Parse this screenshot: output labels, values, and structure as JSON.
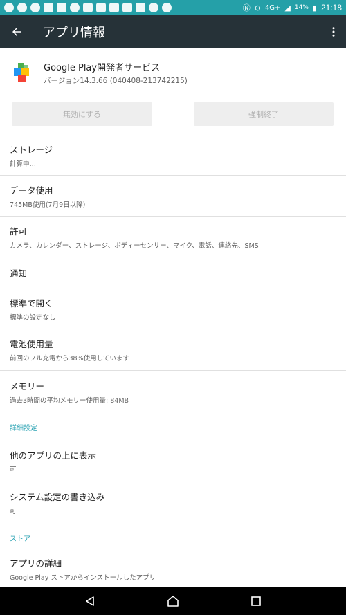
{
  "status_bar": {
    "time": "21:18",
    "battery": "14%",
    "network": "4G+",
    "icons": [
      "message-icon",
      "chat-icon",
      "chat-icon",
      "vine-icon",
      "vine-icon",
      "pinwheel-icon",
      "app-icon",
      "mail-icon",
      "flipboard-icon",
      "home-icon",
      "gmail-icon",
      "chat-bubble-icon",
      "line-icon"
    ]
  },
  "app_bar": {
    "title": "アプリ情報"
  },
  "app": {
    "name": "Google Play開発者サービス",
    "version": "バージョン14.3.66 (040408-213742215)"
  },
  "buttons": {
    "disable": "無効にする",
    "force_stop": "強制終了"
  },
  "items": {
    "storage": {
      "title": "ストレージ",
      "sub": "計算中…"
    },
    "data": {
      "title": "データ使用",
      "sub": "745MB使用(7月9日以降)"
    },
    "permissions": {
      "title": "許可",
      "sub": "カメラ、カレンダー、ストレージ、ボディーセンサー、マイク、電話、連絡先、SMS"
    },
    "notifications": {
      "title": "通知"
    },
    "open_default": {
      "title": "標準で開く",
      "sub": "標準の設定なし"
    },
    "battery": {
      "title": "電池使用量",
      "sub": "前回のフル充電から38%使用しています"
    },
    "memory": {
      "title": "メモリー",
      "sub": "過去3時間の平均メモリー使用量: 84MB"
    },
    "draw_over": {
      "title": "他のアプリの上に表示",
      "sub": "可"
    },
    "write_settings": {
      "title": "システム設定の書き込み",
      "sub": "可"
    },
    "app_details": {
      "title": "アプリの詳細",
      "sub": "Google Play ストアからインストールしたアプリ"
    }
  },
  "sections": {
    "advanced": "詳細設定",
    "store": "ストア"
  },
  "colors": {
    "status_bar": "#25a0a8",
    "app_bar": "#263238",
    "accent": "#2ba3b3"
  }
}
